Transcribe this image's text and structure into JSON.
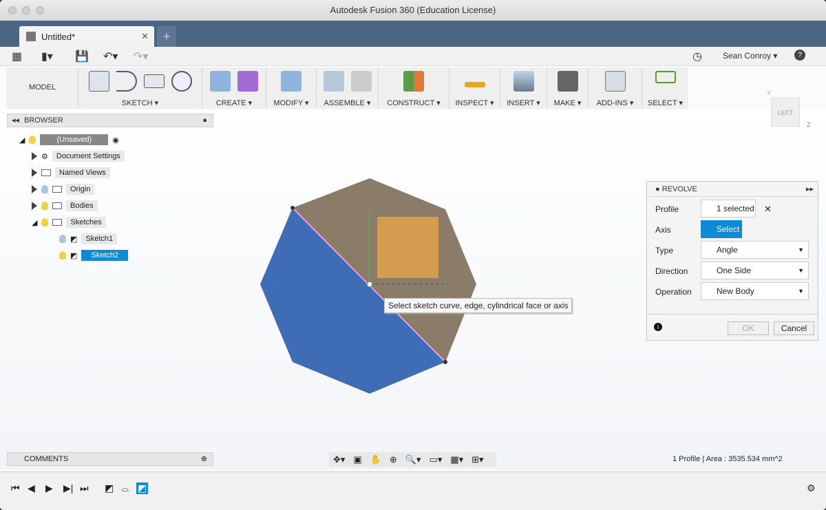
{
  "window": {
    "title": "Autodesk Fusion 360 (Education License)"
  },
  "tabs": [
    {
      "label": "Untitled*"
    }
  ],
  "quickbar": {
    "user": "Sean Conroy",
    "help": "?"
  },
  "ribbon": {
    "workspace": "MODEL",
    "groups": [
      "SKETCH",
      "CREATE",
      "MODIFY",
      "ASSEMBLE",
      "CONSTRUCT",
      "INSPECT",
      "INSERT",
      "MAKE",
      "ADD-INS",
      "SELECT"
    ]
  },
  "viewcube": {
    "face": "LEFT",
    "y": "Y",
    "z": "Z"
  },
  "browser": {
    "title": "BROWSER",
    "root": "(Unsaved)",
    "items": [
      "Document Settings",
      "Named Views",
      "Origin",
      "Bodies",
      "Sketches",
      "Sketch1",
      "Sketch2"
    ]
  },
  "revolve": {
    "title": "REVOLVE",
    "profile_label": "Profile",
    "profile_value": "1 selected",
    "axis_label": "Axis",
    "axis_value": "Select",
    "type_label": "Type",
    "type_value": "Angle",
    "direction_label": "Direction",
    "direction_value": "One Side",
    "operation_label": "Operation",
    "operation_value": "New Body",
    "ok": "OK",
    "cancel": "Cancel",
    "accent": "#0f8ad6"
  },
  "tooltip": "Select sketch curve, edge, cylindrical face or axis",
  "comments": {
    "title": "COMMENTS"
  },
  "status": "1 Profile | Area : 3535.534 mm^2",
  "colors": {
    "profile_blue": "#3e6db5",
    "face_brown": "#8a7c68",
    "orange": "#e0a24a",
    "tabbar": "#4c6583"
  }
}
